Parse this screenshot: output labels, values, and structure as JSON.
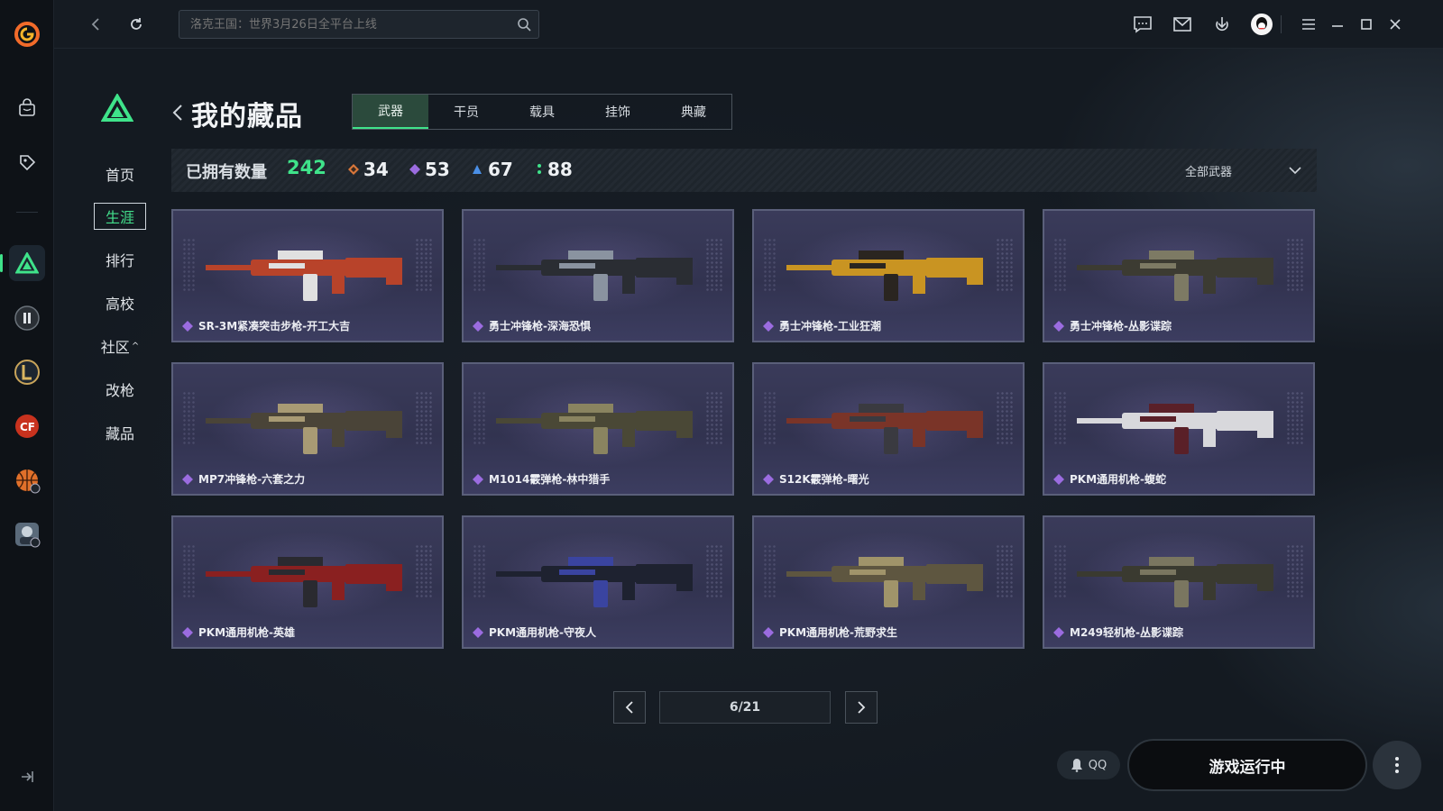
{
  "topbar": {
    "search_placeholder": "洛克王国：世界3月26日全平台上线"
  },
  "nav": {
    "items": [
      {
        "label": "首页",
        "active": false
      },
      {
        "label": "生涯",
        "active": true
      },
      {
        "label": "排行",
        "active": false
      },
      {
        "label": "高校",
        "active": false
      },
      {
        "label": "社区",
        "active": false,
        "caret": "^"
      },
      {
        "label": "改枪",
        "active": false
      },
      {
        "label": "藏品",
        "active": false
      }
    ]
  },
  "header": {
    "title": "我的藏品",
    "tabs": [
      {
        "label": "武器",
        "active": true
      },
      {
        "label": "干员",
        "active": false
      },
      {
        "label": "载具",
        "active": false
      },
      {
        "label": "挂饰",
        "active": false
      },
      {
        "label": "典藏",
        "active": false
      }
    ]
  },
  "stats": {
    "label": "已拥有数量",
    "total": "242",
    "groups": [
      {
        "value": "34",
        "color": "#d9773a"
      },
      {
        "value": "53",
        "color": "#9b6ce0"
      },
      {
        "value": "67",
        "color": "#4a8fe6"
      },
      {
        "value": "88",
        "color": "#3fe38a"
      }
    ],
    "filter_label": "全部武器"
  },
  "items": [
    {
      "name": "SR-3M紧凑突击步枪-开工大吉",
      "rarity_color": "#9b6ce0",
      "palette": [
        "#b8432a",
        "#e0e0e0"
      ]
    },
    {
      "name": "勇士冲锋枪-深海恐惧",
      "rarity_color": "#9b6ce0",
      "palette": [
        "#2a2d33",
        "#8a93a0"
      ]
    },
    {
      "name": "勇士冲锋枪-工业狂潮",
      "rarity_color": "#9b6ce0",
      "palette": [
        "#c99422",
        "#2a2520"
      ]
    },
    {
      "name": "勇士冲锋枪-丛影谍踪",
      "rarity_color": "#9b6ce0",
      "palette": [
        "#3c3b32",
        "#7d7a64"
      ]
    },
    {
      "name": "MP7冲锋枪-六套之力",
      "rarity_color": "#9b6ce0",
      "palette": [
        "#4a4438",
        "#a89a74"
      ]
    },
    {
      "name": "M1014霰弹枪-林中猎手",
      "rarity_color": "#9b6ce0",
      "palette": [
        "#4a4836",
        "#8a8460"
      ]
    },
    {
      "name": "S12K霰弹枪-曙光",
      "rarity_color": "#9b6ce0",
      "palette": [
        "#7a3428",
        "#3a3a40"
      ]
    },
    {
      "name": "PKM通用机枪-蝮蛇",
      "rarity_color": "#9b6ce0",
      "palette": [
        "#d8d8dc",
        "#5a2028"
      ]
    },
    {
      "name": "PKM通用机枪-英雄",
      "rarity_color": "#9b6ce0",
      "palette": [
        "#8a2020",
        "#2a2a30"
      ]
    },
    {
      "name": "PKM通用机枪-守夜人",
      "rarity_color": "#9b6ce0",
      "palette": [
        "#1e2230",
        "#3a44a0"
      ]
    },
    {
      "name": "PKM通用机枪-荒野求生",
      "rarity_color": "#9b6ce0",
      "palette": [
        "#5e5640",
        "#a0946a"
      ]
    },
    {
      "name": "M249轻机枪-丛影谍踪",
      "rarity_color": "#9b6ce0",
      "palette": [
        "#3a3a30",
        "#7a7660"
      ]
    }
  ],
  "pager": {
    "text": "6/21"
  },
  "footer": {
    "qq_label": "QQ",
    "game_status": "游戏运行中"
  },
  "colors": {
    "accent": "#3fe38a",
    "card_bg": "#34355a"
  }
}
